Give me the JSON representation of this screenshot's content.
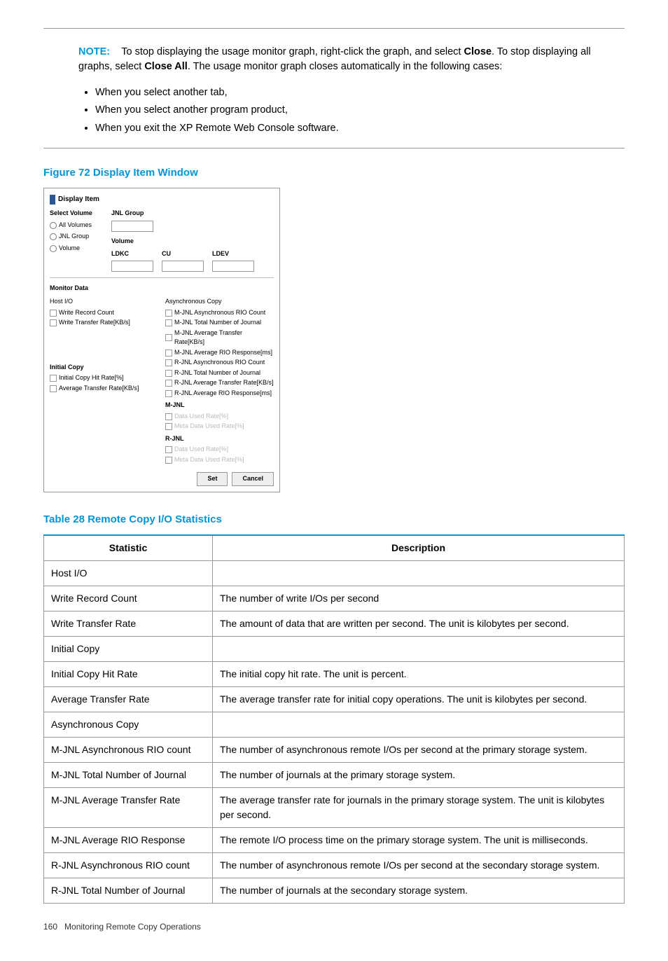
{
  "note": {
    "label": "NOTE:",
    "intro_a": "To stop displaying the usage monitor graph, right-click the graph, and select ",
    "close": "Close",
    "intro_b": ". To stop displaying all graphs, select ",
    "closeall": "Close All",
    "intro_c": ". The usage monitor graph closes automatically in the following cases:",
    "items": [
      "When you select another tab,",
      "When you select another program product,",
      "When you exit the XP Remote Web Console software."
    ]
  },
  "figure": {
    "title": "Figure 72 Display Item Window",
    "dialog_title": "Display Item",
    "select_volume": "Select Volume",
    "all_volumes": "All Volumes",
    "jnl_group_r": "JNL Group",
    "volume_r": "Volume",
    "jnl_group_lbl": "JNL Group",
    "volume_lbl": "Volume",
    "ldkc": "LDKC",
    "cu": "CU",
    "ldev": "LDEV",
    "monitor_data": "Monitor Data",
    "host_io": "Host I/O",
    "wrc": "Write Record Count",
    "wtr": "Write Transfer Rate[KB/s]",
    "initial_copy": "Initial Copy",
    "ichr": "Initial Copy Hit Rate[%]",
    "atr": "Average Transfer Rate[KB/s]",
    "async": "Asynchronous Copy",
    "a1": "M-JNL Asynchronous RIO Count",
    "a2": "M-JNL Total Number of Journal",
    "a3": "M-JNL Average Transfer Rate[KB/s]",
    "a4": "M-JNL Average RIO Response[ms]",
    "a5": "R-JNL Asynchronous RIO Count",
    "a6": "R-JNL Total Number of Journal",
    "a7": "R-JNL Average Transfer Rate[KB/s]",
    "a8": "R-JNL Average RIO Response[ms]",
    "mjnl": "M-JNL",
    "rjnl": "R-JNL",
    "dur": "Data Used Rate[%]",
    "mdur": "Meta Data Used Rate[%]",
    "set": "Set",
    "cancel": "Cancel"
  },
  "table": {
    "title": "Table 28 Remote Copy I/O Statistics",
    "h1": "Statistic",
    "h2": "Description",
    "rows": [
      {
        "s": "Host I/O",
        "d": ""
      },
      {
        "s": "Write Record Count",
        "d": "The number of write I/Os per second"
      },
      {
        "s": "Write Transfer Rate",
        "d": "The amount of data that are written per second. The unit is kilobytes per second."
      },
      {
        "s": "Initial Copy",
        "d": ""
      },
      {
        "s": "Initial Copy Hit Rate",
        "d": "The initial copy hit rate. The unit is percent."
      },
      {
        "s": "Average Transfer Rate",
        "d": "The average transfer rate for initial copy operations. The unit is kilobytes per second."
      },
      {
        "s": "Asynchronous Copy",
        "d": ""
      },
      {
        "s": "M-JNL Asynchronous RIO count",
        "d": "The number of asynchronous remote I/Os per second at the primary storage system."
      },
      {
        "s": "M-JNL Total Number of Journal",
        "d": "The number of journals at the primary storage system."
      },
      {
        "s": "M-JNL Average Transfer Rate",
        "d": "The average transfer rate for journals in the primary storage system. The unit is kilobytes per second."
      },
      {
        "s": "M-JNL Average RIO Response",
        "d": "The remote I/O process time on the primary storage system. The unit is milliseconds."
      },
      {
        "s": "R-JNL Asynchronous RIO count",
        "d": "The number of asynchronous remote I/Os per second at the secondary storage system."
      },
      {
        "s": "R-JNL Total Number of Journal",
        "d": "The number of journals at the secondary storage system."
      }
    ]
  },
  "footer": {
    "page": "160",
    "chapter": "Monitoring Remote Copy Operations"
  }
}
